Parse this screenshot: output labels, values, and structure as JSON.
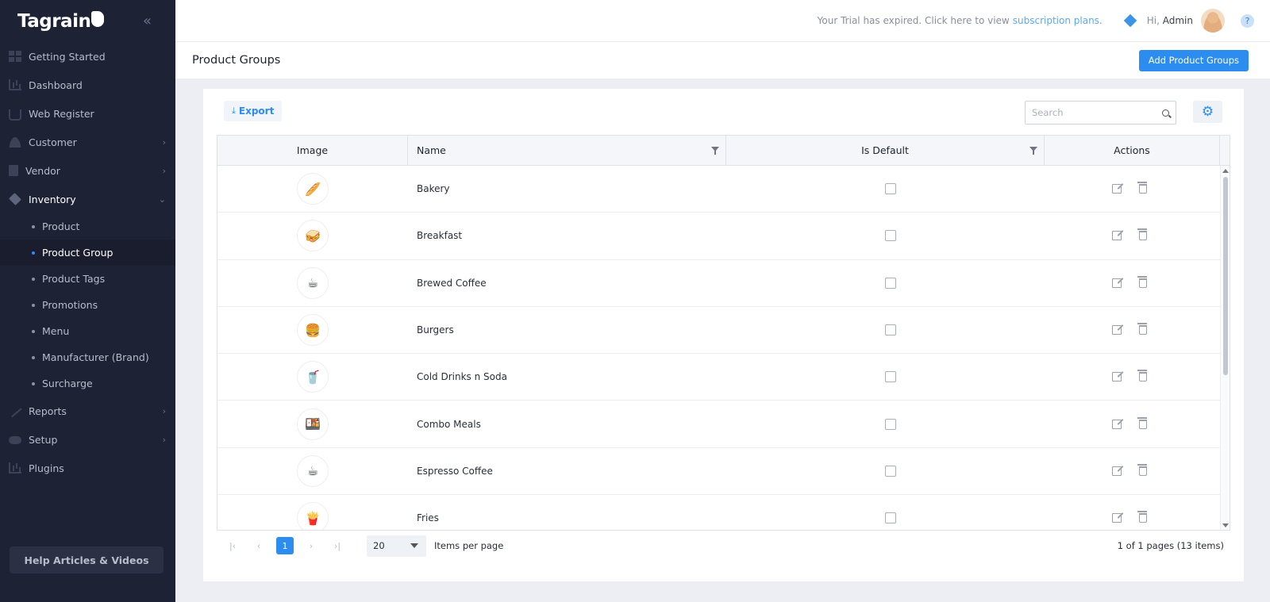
{
  "app": {
    "logo_text": "Tagrain"
  },
  "sidebar": {
    "items": [
      {
        "label": "Getting Started",
        "icon": "grid-icon",
        "chevron": false
      },
      {
        "label": "Dashboard",
        "icon": "chart-icon",
        "chevron": false
      },
      {
        "label": "Web Register",
        "icon": "cart-icon",
        "chevron": false
      },
      {
        "label": "Customer",
        "icon": "user-icon",
        "chevron": true
      },
      {
        "label": "Vendor",
        "icon": "building-icon",
        "chevron": true
      },
      {
        "label": "Inventory",
        "icon": "box-icon",
        "chevron": true,
        "expanded": true
      }
    ],
    "sub_items": [
      {
        "label": "Product"
      },
      {
        "label": "Product Group",
        "active": true
      },
      {
        "label": "Product Tags"
      },
      {
        "label": "Promotions"
      },
      {
        "label": "Menu"
      },
      {
        "label": "Manufacturer (Brand)"
      },
      {
        "label": "Surcharge"
      }
    ],
    "bottom_items": [
      {
        "label": "Reports",
        "icon": "pen-icon",
        "chevron": true
      },
      {
        "label": "Setup",
        "icon": "toggle-icon",
        "chevron": true
      },
      {
        "label": "Plugins",
        "icon": "chart-icon",
        "chevron": false
      }
    ],
    "help_button": "Help Articles & Videos"
  },
  "topbar": {
    "trial_text": "Your Trial has expired. Click here to view",
    "trial_link": "subscription plans.",
    "greeting": "Hi,",
    "user": "Admin",
    "help": "?"
  },
  "page": {
    "title": "Product Groups",
    "add_button": "Add Product Groups"
  },
  "toolbar": {
    "export_label": "Export",
    "search_placeholder": "Search"
  },
  "grid": {
    "columns": [
      "Image",
      "Name",
      "Is Default",
      "Actions"
    ],
    "rows": [
      {
        "name": "Bakery",
        "is_default": false,
        "icon": "bread-icon",
        "glyph": "🥖"
      },
      {
        "name": "Breakfast",
        "is_default": false,
        "icon": "breakfast-icon",
        "glyph": "🥪"
      },
      {
        "name": "Brewed Coffee",
        "is_default": false,
        "icon": "coffee-icon",
        "glyph": "☕"
      },
      {
        "name": "Burgers",
        "is_default": false,
        "icon": "burger-icon",
        "glyph": "🍔"
      },
      {
        "name": "Cold Drinks n Soda",
        "is_default": false,
        "icon": "drink-icon",
        "glyph": "🥤"
      },
      {
        "name": "Combo Meals",
        "is_default": false,
        "icon": "combo-icon",
        "glyph": "🍱"
      },
      {
        "name": "Espresso Coffee",
        "is_default": false,
        "icon": "espresso-icon",
        "glyph": "☕"
      },
      {
        "name": "Fries",
        "is_default": false,
        "icon": "fries-icon",
        "glyph": "🍟"
      }
    ]
  },
  "pager": {
    "current_page": "1",
    "page_size": "20",
    "items_per_page_label": "Items per page",
    "info": "1 of 1 pages (13 items)"
  },
  "colors": {
    "accent": "#2d8cf0",
    "sidebar_bg": "#1e2235",
    "page_bg": "#eceef3"
  }
}
